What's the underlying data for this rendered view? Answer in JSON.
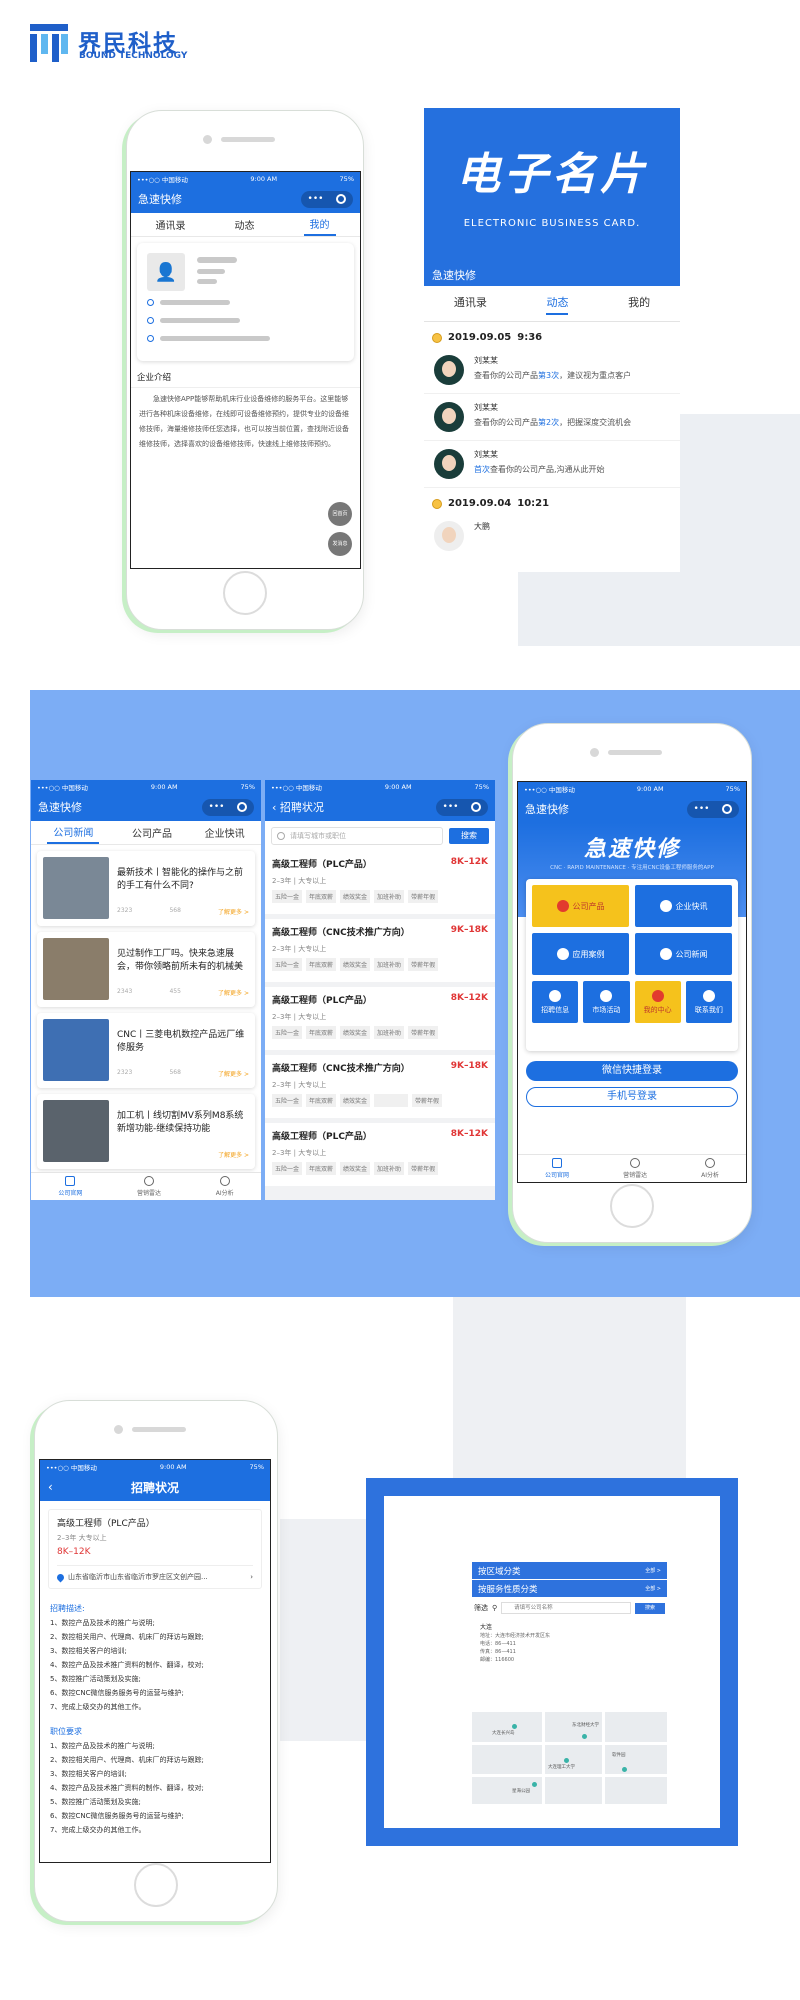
{
  "brand": {
    "name_cn": "界民科技",
    "name_en": "BOUND TECHNOLOGY",
    "color": "#1f5fc9"
  },
  "common": {
    "carrier": "•••○○ 中国移动 ",
    "time": "9:00 AM",
    "battery": "75%",
    "app_name": "急速快修",
    "capsule_more": "•••"
  },
  "profile_screen": {
    "tabs": [
      "通讯录",
      "动态",
      "我的"
    ],
    "intro_title": "企业介绍",
    "intro_text": "急速快修APP能够帮助机床行业设备维修的服务平台。这里能够进行各种机床设备维修，在线即可设备维修预约，提供专业的设备维修技师，海量维修技师任您选择，也可以按当前位置，查找附近设备维修技师，选择喜欢的设备维修技师，快速线上维修技师预约。",
    "fab_home": "回首页",
    "fab_msg": "发消息"
  },
  "ecard": {
    "title": "电子名片",
    "subtitle": "ELECTRONIC BUSINESS CARD.",
    "app_name": "急速快修",
    "tabs": [
      "通讯录",
      "动态",
      "我的"
    ],
    "groups": [
      {
        "date": "2019.09.05",
        "time": "9:36",
        "items": [
          {
            "name": "刘某某",
            "pre": "查看你的公司产品",
            "hl": "第3次",
            "post": "，建议视为重点客户"
          },
          {
            "name": "刘某某",
            "pre": "查看你的公司产品",
            "hl": "第2次",
            "post": "，把握深度交流机会"
          },
          {
            "name": "刘某某",
            "pre": "",
            "hl": "首次",
            "post": "查看你的公司产品,沟通从此开始"
          }
        ]
      },
      {
        "date": "2019.09.04",
        "time": "10:21",
        "items": [
          {
            "name": "大鹏",
            "pre": "",
            "hl": "",
            "post": ""
          }
        ]
      }
    ]
  },
  "news_screen": {
    "tabs": [
      "公司新闻",
      "公司产品",
      "企业快讯"
    ],
    "items": [
      {
        "title": "最新技术丨智能化的操作与之前的手工有什么不同?",
        "views": "2323",
        "likes": "568",
        "more": "了解更多 >"
      },
      {
        "title": "见过制作工厂吗。快来急速展会，带你领略前所未有的机械美",
        "views": "2343",
        "likes": "455",
        "more": "了解更多 >"
      },
      {
        "title": "CNC丨三菱电机数控产品远厂维修服务",
        "views": "2323",
        "likes": "568",
        "more": "了解更多 >"
      },
      {
        "title": "加工机丨线切割MV系列M8系统新增功能-继续保持功能",
        "views": "",
        "likes": "",
        "more": "了解更多 >"
      }
    ],
    "tabbar": [
      "公司官网",
      "营销雷达",
      "AI分析"
    ]
  },
  "jobs_screen": {
    "title": "招聘状况",
    "search_placeholder": "请填写城市或职位",
    "search_button": "搜索",
    "jobs": [
      {
        "title": "高级工程师（PLC产品）",
        "salary": "8K–12K",
        "exp": "2–3年  |  大专以上",
        "chips": [
          "五险一金",
          "年底双薪",
          "绩效奖金",
          "加班补助",
          "带薪年假"
        ]
      },
      {
        "title": "高级工程师（CNC技术推广方向）",
        "salary": "9K–18K",
        "exp": "2–3年  |  大专以上",
        "chips": [
          "五险一金",
          "年底双薪",
          "绩效奖金",
          "加班补助",
          "带薪年假"
        ]
      },
      {
        "title": "高级工程师（PLC产品）",
        "salary": "8K–12K",
        "exp": "2–3年  |  大专以上",
        "chips": [
          "五险一金",
          "年底双薪",
          "绩效奖金",
          "加班补助",
          "带薪年假"
        ]
      },
      {
        "title": "高级工程师（CNC技术推广方向）",
        "salary": "9K–18K",
        "exp": "2–3年  |  大专以上",
        "chips": [
          "五险一金",
          "年底双薪",
          "绩效奖金",
          "",
          "带薪年假"
        ]
      },
      {
        "title": "高级工程师（PLC产品）",
        "salary": "8K–12K",
        "exp": "2–3年  |  大专以上",
        "chips": [
          "五险一金",
          "年底双薪",
          "绩效奖金",
          "加班补助",
          "带薪年假"
        ]
      }
    ]
  },
  "home_screen": {
    "hero_title": "急速快修",
    "hero_sub": "CNC · RAPID MAINTENANCE · 专注用CNC设备工程师服务的APP",
    "tiles_big": [
      {
        "label": "公司产品",
        "color": "yellow"
      },
      {
        "label": "企业快讯",
        "color": "blue"
      },
      {
        "label": "应用案例",
        "color": "blue"
      },
      {
        "label": "公司新闻",
        "color": "blue"
      }
    ],
    "tiles_small": [
      {
        "label": "招聘信息",
        "color": "blue"
      },
      {
        "label": "市场活动",
        "color": "blue"
      },
      {
        "label": "我的中心",
        "color": "yellow"
      },
      {
        "label": "联系我们",
        "color": "blue"
      }
    ],
    "wechat_login": "微信快捷登录",
    "phone_login": "手机号登录",
    "tabbar": [
      "公司官网",
      "营销雷达",
      "AI分析"
    ]
  },
  "job_detail": {
    "title": "招聘状况",
    "job_title": "高级工程师（PLC产品）",
    "exp": "2–3年   大专以上",
    "salary": "8K–12K",
    "address": "山东省临沂市山东省临沂市罗庄区文创产园...",
    "desc_head": "招聘描述:",
    "desc": [
      "1、数控产品及技术的推广与说明;",
      "2、数控相关用户、代理商、机床厂的拜访与跟踪;",
      "3、数控相关客户的培训;",
      "4、数控产品及技术推广资料的制作、翻译，校对;",
      "5、数控推广活动策划及实施;",
      "6、数控CNC微信服务服务号的运营与维护;",
      "7、完成上级交办的其他工作。"
    ],
    "req_head": "职位要求",
    "req": [
      "1、数控产品及技术的推广与说明;",
      "2、数控相关用户、代理商、机床厂的拜访与跟踪;",
      "3、数控相关客户的培训;",
      "4、数控产品及技术推广资料的制作、翻译，校对;",
      "5、数控推广活动策划及实施;",
      "6、数控CNC微信服务服务号的运营与维护;",
      "7、完成上级交办的其他工作。"
    ]
  },
  "map_screen": {
    "cat1": "按区域分类",
    "cat2": "按服务性质分类",
    "cat_more": "全部 >",
    "filter_label": "筛选",
    "filter_placeholder": "请填写公司名称",
    "filter_button": "搜索",
    "company": "大连",
    "addr_lines": [
      "地址：大连市经济技术开发区东",
      "电话：86—411",
      "传真：86—411",
      "邮编：116600"
    ],
    "map_labels": [
      "大连长兴岛",
      "东北财经大学",
      "大连理工大学",
      "软件园",
      "星海公园"
    ]
  }
}
